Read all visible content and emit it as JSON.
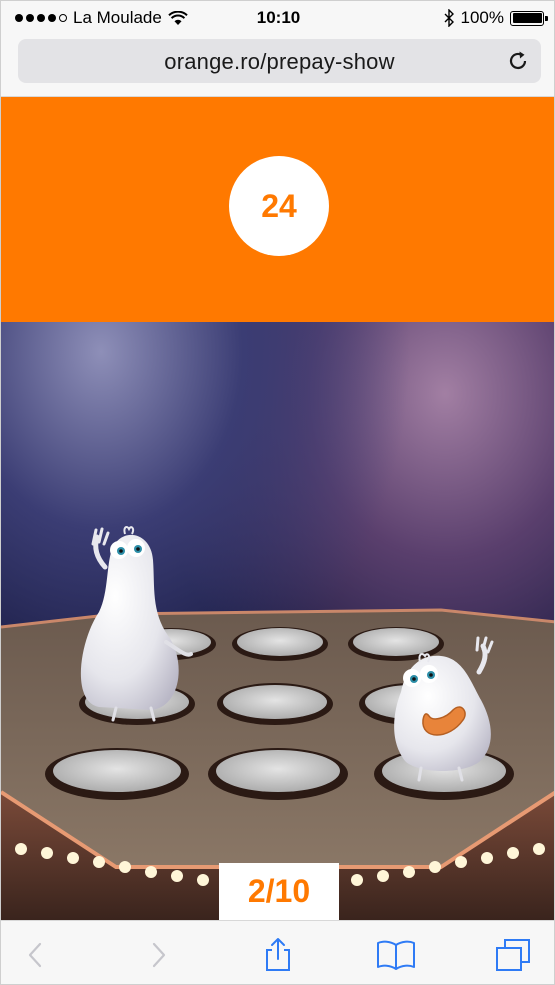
{
  "status_bar": {
    "carrier": "La Moulade",
    "time": "10:10",
    "battery_percent": "100%",
    "battery_level": 1.0
  },
  "address_bar": {
    "url": "orange.ro/prepay-show",
    "reload_icon": "reload-icon"
  },
  "game": {
    "timer_value": "24",
    "progress": "2/10",
    "accent_color": "#ff7900"
  },
  "toolbar": {
    "back_icon": "chevron-left-icon",
    "forward_icon": "chevron-right-icon",
    "share_icon": "share-icon",
    "bookmarks_icon": "book-icon",
    "tabs_icon": "tabs-icon",
    "tint_color": "#2f7bf5"
  }
}
